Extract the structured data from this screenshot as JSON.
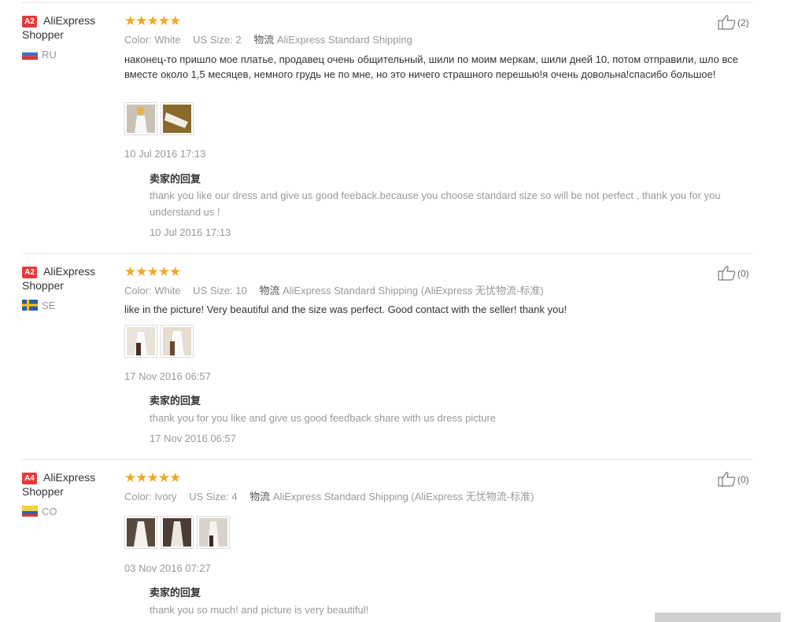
{
  "reviews": [
    {
      "badge": "A2",
      "user_name": "AliExpress",
      "user_role": "Shopper",
      "country": "RU",
      "stars": "★★★★★",
      "color_label": "Color:",
      "color_value": "White",
      "size_label": "US Size:",
      "size_value": "2",
      "ship_label": "物流",
      "ship_value": "AliExpress Standard Shipping",
      "text": "наконец-то пришло мое платье, продавец очень общительный, шили по моим меркам, шили дней 10, потом отправили, шло все вместе около 1,5 месяцев, немного грудь не по мне, но это ничего страшного перешью!я очень довольна!спасибо большое!",
      "date": "10 Jul 2016 17:13",
      "likes": "(2)",
      "reply_title": "卖家的回复",
      "reply_text": "thank you like our dress and give us good feeback.because you choose standard size so will be not perfect , thank you for you understand us !",
      "reply_date": "10 Jul 2016 17:13"
    },
    {
      "badge": "A2",
      "user_name": "AliExpress",
      "user_role": "Shopper",
      "country": "SE",
      "stars": "★★★★★",
      "color_label": "Color:",
      "color_value": "White",
      "size_label": "US Size:",
      "size_value": "10",
      "ship_label": "物流",
      "ship_value": "AliExpress Standard Shipping (AliExpress 无忧物流-标准)",
      "text": "like in the picture! Very beautiful and the size was perfect. Good contact with the seller! thank you!",
      "date": "17 Nov 2016 06:57",
      "likes": "(0)",
      "reply_title": "卖家的回复",
      "reply_text": "thank you for you like and give us good feedback share with us dress picture",
      "reply_date": "17 Nov 2016 06:57"
    },
    {
      "badge": "A4",
      "user_name": "AliExpress",
      "user_role": "Shopper",
      "country": "CO",
      "stars": "★★★★★",
      "color_label": "Color:",
      "color_value": "Ivory",
      "size_label": "US Size:",
      "size_value": "4",
      "ship_label": "物流",
      "ship_value": "AliExpress Standard Shipping (AliExpress 无忧物流-标准)",
      "text": "",
      "date": "03 Nov 2016 07:27",
      "likes": "(0)",
      "reply_title": "卖家的回复",
      "reply_text": "thank you so much! and picture is very beautiful!",
      "reply_date": ""
    }
  ],
  "colors": {
    "badge": "#e4393c",
    "star": "#f5a623",
    "muted": "#999999"
  },
  "icons": {
    "like": "thumbs-up-icon",
    "review_photo": "photo-thumbnail-icon"
  }
}
